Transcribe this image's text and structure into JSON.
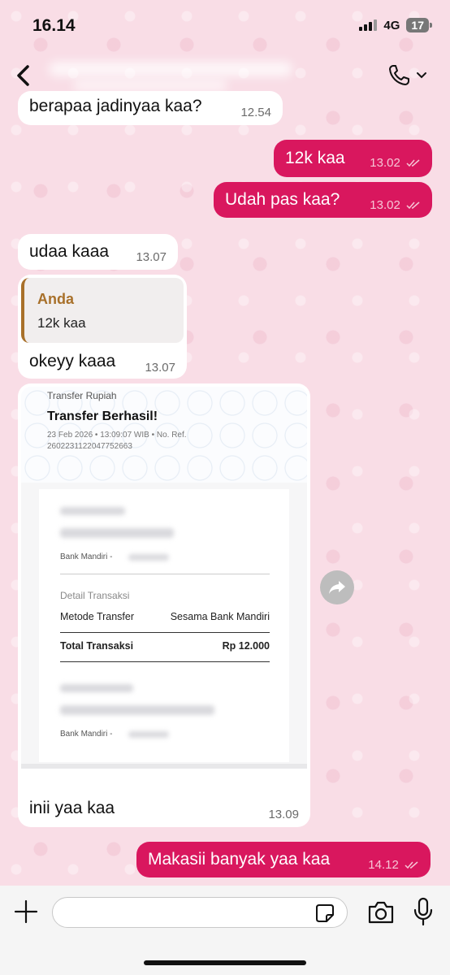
{
  "status": {
    "time": "16.14",
    "network": "4G",
    "battery": "17"
  },
  "header": {
    "back_icon": "chevron-left-icon",
    "call_icon": "phone-icon",
    "call_menu_icon": "chevron-down-icon"
  },
  "messages": [
    {
      "id": "m1",
      "dir": "in",
      "text": "berapaa jadinyaa kaa?",
      "time": "12.54"
    },
    {
      "id": "m2",
      "dir": "out",
      "text": "12k kaa",
      "time": "13.02",
      "status": "read"
    },
    {
      "id": "m3",
      "dir": "out",
      "text": "Udah pas kaa?",
      "time": "13.02",
      "status": "read"
    },
    {
      "id": "m4",
      "dir": "in",
      "text": "udaa kaaa",
      "time": "13.07"
    },
    {
      "id": "m5",
      "dir": "in",
      "text": "okeyy kaaa",
      "time": "13.07",
      "quote": {
        "author": "Anda",
        "text": "12k kaa"
      }
    },
    {
      "id": "m6",
      "dir": "in",
      "text": "inii yaa kaa",
      "time": "13.09"
    },
    {
      "id": "m7",
      "dir": "out",
      "text": "Makasii banyak yaa kaa",
      "time": "14.12",
      "status": "read"
    }
  ],
  "receipt": {
    "label": "Transfer Rupiah",
    "title": "Transfer Berhasil!",
    "date": "23 Feb 2026 • 13:09:07 WIB • No. Ref.",
    "ref": "2602231122047752663",
    "bank_line": "Bank Mandiri -",
    "detail_title": "Detail Transaksi",
    "method_label": "Metode Transfer",
    "method_value": "Sesama Bank Mandiri",
    "total_label": "Total Transaksi",
    "total_value": "Rp 12.000",
    "bank_line_2": "Bank Mandiri -"
  },
  "input": {
    "placeholder": ""
  },
  "colors": {
    "outgoing": "#d9175e",
    "incoming": "#ffffff",
    "quote_accent": "#a8702a",
    "background": "#f9dde6"
  }
}
